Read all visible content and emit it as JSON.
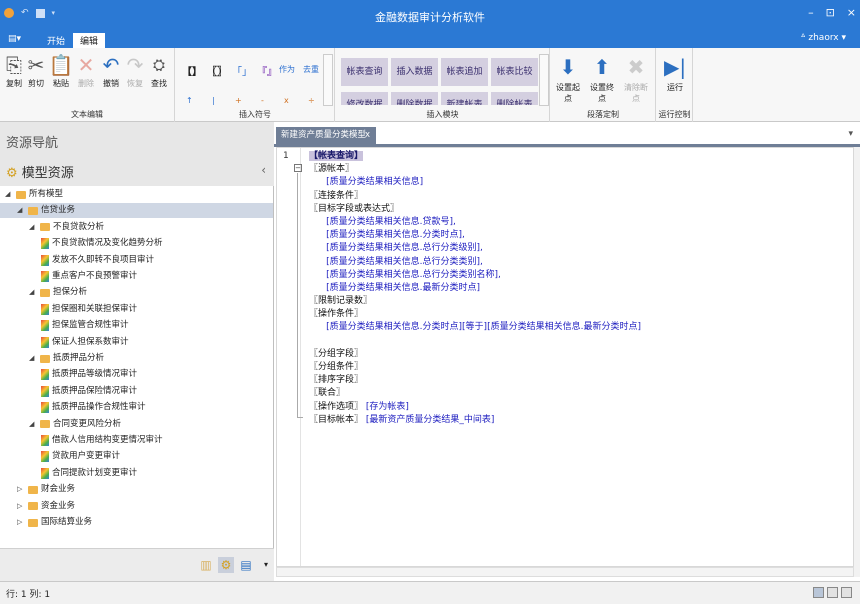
{
  "window": {
    "title": "金融数据审计分析软件",
    "min": "–",
    "max": "⊡",
    "close": "×"
  },
  "tabs": [
    "开始",
    "编辑"
  ],
  "user": "zhaorx",
  "ribbon": {
    "text_edit": {
      "label": "文本编辑",
      "buttons": [
        "复制",
        "剪切",
        "粘贴",
        "删除",
        "撤销",
        "恢复",
        "查找"
      ]
    },
    "symbols": {
      "label": "插入符号",
      "row1": [
        "【】",
        "〖〗",
        "「」",
        "『』",
        "作为",
        "去重"
      ],
      "row2": [
        "↑",
        "|",
        "+",
        "-",
        "x",
        "÷"
      ]
    },
    "modules": {
      "label": "插入模块",
      "tiles": [
        "帐表查询",
        "插入数据",
        "帐表追加",
        "帐表比较",
        "修改数据",
        "删除数据",
        "新建帐表",
        "删除帐表"
      ]
    },
    "para": {
      "label": "段落定制",
      "buttons": [
        "设置起点",
        "设置终点",
        "清除断点"
      ]
    },
    "run": {
      "label": "运行控制",
      "button": "运行"
    }
  },
  "left": {
    "header": "资源导航",
    "section": "模型资源",
    "tree": [
      {
        "label": "所有模型",
        "level": 0,
        "type": "folder",
        "open": true
      },
      {
        "label": "信贷业务",
        "level": 1,
        "type": "folder",
        "open": true,
        "selected": true
      },
      {
        "label": "不良贷款分析",
        "level": 2,
        "type": "folder",
        "open": true
      },
      {
        "label": "不良贷款情况及变化趋势分析",
        "level": 3,
        "type": "report"
      },
      {
        "label": "发放不久即转不良项目审计",
        "level": 3,
        "type": "report"
      },
      {
        "label": "重点客户不良预警审计",
        "level": 3,
        "type": "report"
      },
      {
        "label": "担保分析",
        "level": 2,
        "type": "folder",
        "open": true
      },
      {
        "label": "担保圈和关联担保审计",
        "level": 3,
        "type": "report"
      },
      {
        "label": "担保监管合规性审计",
        "level": 3,
        "type": "report"
      },
      {
        "label": "保证人担保系数审计",
        "level": 3,
        "type": "report"
      },
      {
        "label": "抵质押品分析",
        "level": 2,
        "type": "folder",
        "open": true
      },
      {
        "label": "抵质押品等级情况审计",
        "level": 3,
        "type": "report"
      },
      {
        "label": "抵质押品保险情况审计",
        "level": 3,
        "type": "report"
      },
      {
        "label": "抵质押品操作合规性审计",
        "level": 3,
        "type": "report"
      },
      {
        "label": "合同变更风险分析",
        "level": 2,
        "type": "folder",
        "open": true
      },
      {
        "label": "借款人信用结构变更情况审计",
        "level": 3,
        "type": "report"
      },
      {
        "label": "贷款用户变更审计",
        "level": 3,
        "type": "report"
      },
      {
        "label": "合同提款计划变更审计",
        "level": 3,
        "type": "report"
      },
      {
        "label": "财会业务",
        "level": 1,
        "type": "folder",
        "open": false
      },
      {
        "label": "资金业务",
        "level": 1,
        "type": "folder",
        "open": false
      },
      {
        "label": "国际结算业务",
        "level": 1,
        "type": "folder",
        "open": false
      }
    ]
  },
  "doc": {
    "tab": "新建资产质量分类模型",
    "close": "x",
    "line_number": "1",
    "code": [
      {
        "t": "hl",
        "s": "【帐表查询】"
      },
      {
        "t": "kw",
        "s": "〖源帐本〗"
      },
      {
        "t": "lk",
        "s": "      [质量分类结果相关信息]"
      },
      {
        "t": "kw",
        "s": "〖连接条件〗"
      },
      {
        "t": "kw",
        "s": "〖目标字段或表达式〗"
      },
      {
        "t": "lk",
        "s": "      [质量分类结果相关信息.贷款号],"
      },
      {
        "t": "lk",
        "s": "      [质量分类结果相关信息.分类时点],"
      },
      {
        "t": "lk",
        "s": "      [质量分类结果相关信息.总行分类级别],"
      },
      {
        "t": "lk",
        "s": "      [质量分类结果相关信息.总行分类类别],"
      },
      {
        "t": "lk",
        "s": "      [质量分类结果相关信息.总行分类类别名称],"
      },
      {
        "t": "lk",
        "s": "      [质量分类结果相关信息.最新分类时点]"
      },
      {
        "t": "kw",
        "s": "〖限制记录数〗"
      },
      {
        "t": "kw",
        "s": "〖操作条件〗"
      },
      {
        "t": "lk",
        "s": "      [质量分类结果相关信息.分类时点][等于][质量分类结果相关信息.最新分类时点]"
      },
      {
        "t": "kw",
        "s": ""
      },
      {
        "t": "kw",
        "s": "〖分组字段〗"
      },
      {
        "t": "kw",
        "s": "〖分组条件〗"
      },
      {
        "t": "kw",
        "s": "〖排序字段〗"
      },
      {
        "t": "kw",
        "s": "〖联合〗"
      },
      {
        "t": "mix",
        "a": "〖操作选项〗",
        "b": "[存为帐表]"
      },
      {
        "t": "mix",
        "a": "〖目标帐本〗",
        "b": "[最新资产质量分类结果_中间表]"
      }
    ]
  },
  "status": {
    "pos": "行: 1  列: 1"
  }
}
